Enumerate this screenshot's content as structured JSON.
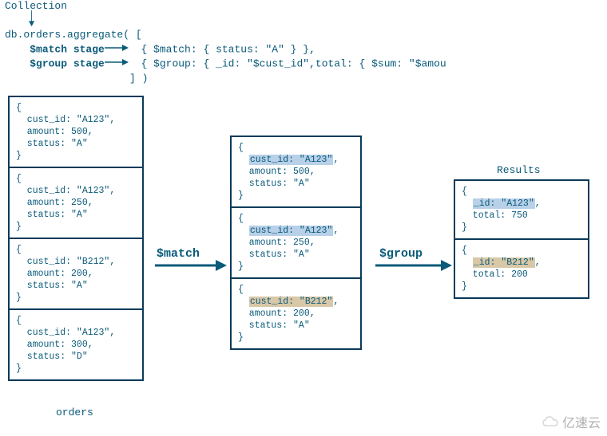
{
  "header": {
    "collection_label": "Collection",
    "line1": "db.orders.aggregate( [",
    "match_label": "$match stage",
    "match_code": "{ $match: { status: \"A\" } },",
    "group_label": "$group stage",
    "group_code": "{ $group: { _id: \"$cust_id\",total: { $sum: \"$amou",
    "close": "] )"
  },
  "orders": {
    "caption": "orders",
    "docs": [
      {
        "l1": "{",
        "l2": "  cust_id: \"A123\",",
        "l3": "  amount: 500,",
        "l4": "  status: \"A\"",
        "l5": "}"
      },
      {
        "l1": "{",
        "l2": "  cust_id: \"A123\",",
        "l3": "  amount: 250,",
        "l4": "  status: \"A\"",
        "l5": "}"
      },
      {
        "l1": "{",
        "l2": "  cust_id: \"B212\",",
        "l3": "  amount: 200,",
        "l4": "  status: \"A\"",
        "l5": "}"
      },
      {
        "l1": "{",
        "l2": "  cust_id: \"A123\",",
        "l3": "  amount: 300,",
        "l4": "  status: \"D\"",
        "l5": "}"
      }
    ]
  },
  "matched": {
    "docs": [
      {
        "l1": "{",
        "hl": "cust_id: \"A123\"",
        "comma": ",",
        "l3": "  amount: 500,",
        "l4": "  status: \"A\"",
        "l5": "}"
      },
      {
        "l1": "{",
        "hl": "cust_id: \"A123\"",
        "comma": ",",
        "l3": "  amount: 250,",
        "l4": "  status: \"A\"",
        "l5": "}"
      },
      {
        "l1": "{",
        "hl": "cust_id: \"B212\"",
        "comma": ",",
        "l3": "  amount: 200,",
        "l4": "  status: \"A\"",
        "l5": "}"
      }
    ]
  },
  "results": {
    "title": "Results",
    "docs": [
      {
        "l1": "{",
        "hl": "_id: \"A123\"",
        "comma": ",",
        "l3": "  total: 750",
        "l4": "}"
      },
      {
        "l1": "{",
        "hl": "_id: \"B212\"",
        "comma": ",",
        "l3": "  total: 200",
        "l4": "}"
      }
    ]
  },
  "pipeline": {
    "match": "$match",
    "group": "$group"
  },
  "watermark": "亿速云"
}
